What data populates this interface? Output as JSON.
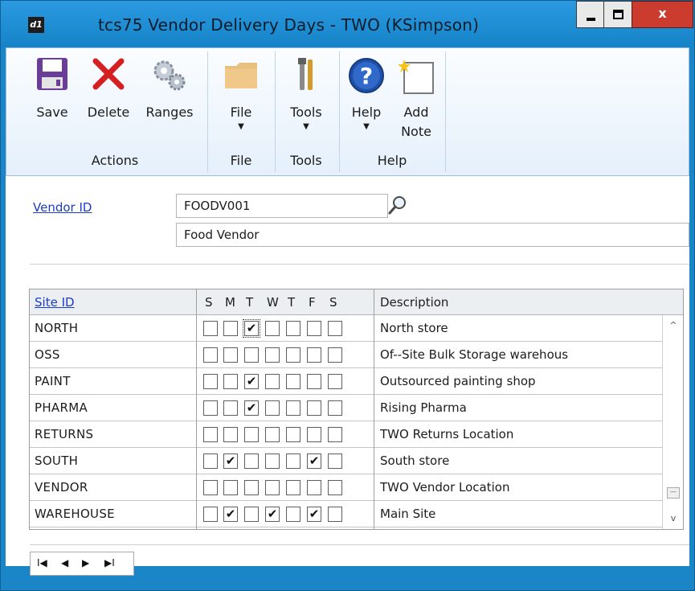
{
  "window": {
    "title": "tcs75 Vendor Delivery Days  -  TWO (KSimpson)",
    "close_glyph": "x"
  },
  "ribbon": {
    "groups": {
      "actions": "Actions",
      "file": "File",
      "tools": "Tools",
      "help": "Help"
    },
    "buttons": {
      "save": "Save",
      "delete": "Delete",
      "ranges": "Ranges",
      "file": "File",
      "tools": "Tools",
      "help": "Help",
      "add_note_line1": "Add",
      "add_note_line2": "Note"
    },
    "icons": [
      "save-icon",
      "delete-icon",
      "ranges-gears-icon",
      "file-folder-icon",
      "tools-icon",
      "help-icon",
      "add-note-icon"
    ],
    "accent": "#1a86c8"
  },
  "vendor": {
    "label": "Vendor ID",
    "id": "FOODV001",
    "name": "Food Vendor"
  },
  "grid": {
    "headers": {
      "site_id": "Site ID",
      "days": [
        "S",
        "M",
        "T",
        "W",
        "T",
        "F",
        "S"
      ],
      "description": "Description"
    },
    "rows": [
      {
        "site": "NORTH",
        "days": [
          false,
          false,
          true,
          false,
          false,
          false,
          false
        ],
        "description": "North store"
      },
      {
        "site": "OSS",
        "days": [
          false,
          false,
          false,
          false,
          false,
          false,
          false
        ],
        "description": "Of--Site Bulk Storage warehous"
      },
      {
        "site": "PAINT",
        "days": [
          false,
          false,
          true,
          false,
          false,
          false,
          false
        ],
        "description": "Outsourced painting shop"
      },
      {
        "site": "PHARMA",
        "days": [
          false,
          false,
          true,
          false,
          false,
          false,
          false
        ],
        "description": "Rising Pharma"
      },
      {
        "site": "RETURNS",
        "days": [
          false,
          false,
          false,
          false,
          false,
          false,
          false
        ],
        "description": "TWO Returns Location"
      },
      {
        "site": "SOUTH",
        "days": [
          false,
          true,
          false,
          false,
          false,
          true,
          false
        ],
        "description": "South store"
      },
      {
        "site": "VENDOR",
        "days": [
          false,
          false,
          false,
          false,
          false,
          false,
          false
        ],
        "description": "TWO Vendor Location"
      },
      {
        "site": "WAREHOUSE",
        "days": [
          false,
          true,
          false,
          true,
          false,
          true,
          false
        ],
        "description": "Main Site"
      }
    ],
    "focused_cell": {
      "row": 0,
      "day": 2
    }
  },
  "navigation": {
    "first": "I◀",
    "prev": "◀",
    "next": "▶",
    "last": "▶I"
  }
}
